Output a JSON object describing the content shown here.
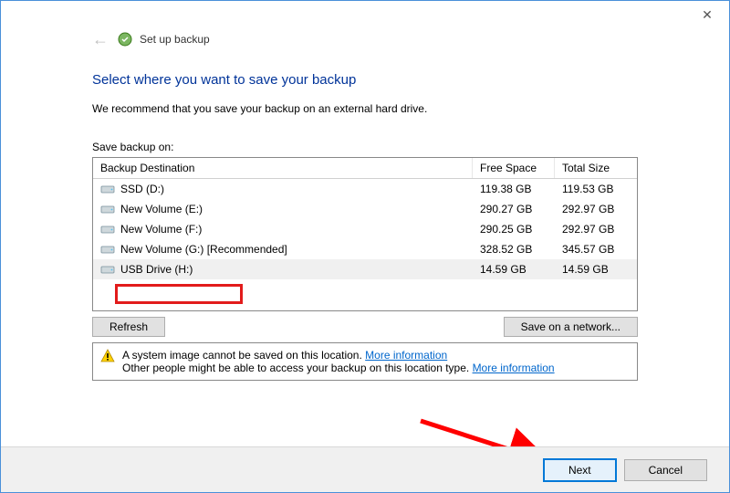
{
  "titlebar": {},
  "header": {
    "title": "Set up backup"
  },
  "main": {
    "heading": "Select where you want to save your backup",
    "recommend": "We recommend that you save your backup on an external hard drive.",
    "list_label": "Save backup on:",
    "columns": {
      "dest": "Backup Destination",
      "free": "Free Space",
      "total": "Total Size"
    },
    "drives": [
      {
        "name": "SSD (D:)",
        "free": "119.38 GB",
        "total": "119.53 GB",
        "selected": false
      },
      {
        "name": "New Volume (E:)",
        "free": "290.27 GB",
        "total": "292.97 GB",
        "selected": false
      },
      {
        "name": "New Volume (F:)",
        "free": "290.25 GB",
        "total": "292.97 GB",
        "selected": false
      },
      {
        "name": "New Volume (G:) [Recommended]",
        "free": "328.52 GB",
        "total": "345.57 GB",
        "selected": false
      },
      {
        "name": "USB Drive (H:)",
        "free": "14.59 GB",
        "total": "14.59 GB",
        "selected": true
      }
    ],
    "refresh_label": "Refresh",
    "network_label": "Save on a network...",
    "warning": {
      "line1_text": "A system image cannot be saved on this location. ",
      "line1_link": "More information",
      "line2_text": "Other people might be able to access your backup on this location type. ",
      "line2_link": "More information"
    }
  },
  "footer": {
    "next_label": "Next",
    "cancel_label": "Cancel"
  }
}
